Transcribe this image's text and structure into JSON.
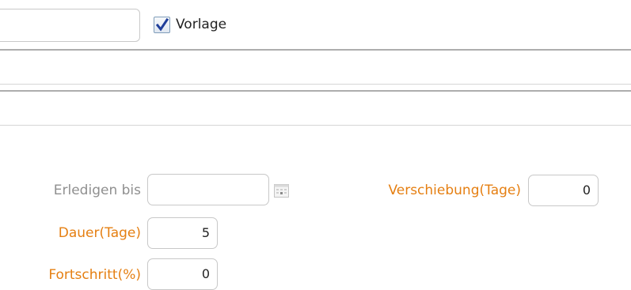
{
  "header": {
    "vorlage_label": "Vorlage",
    "vorlage_checked": true
  },
  "form": {
    "erledigen_bis": {
      "label": "Erledigen bis",
      "value": ""
    },
    "verschiebung": {
      "label": "Verschiebung(Tage)",
      "value": "0"
    },
    "dauer": {
      "label": "Dauer(Tage)",
      "value": "5"
    },
    "fortschritt": {
      "label": "Fortschritt(%)",
      "value": "0"
    }
  },
  "colors": {
    "required_label": "#e57f12",
    "optional_label": "#8f8f8f",
    "checkbox_tick": "#1f3e9a"
  },
  "icons": [
    "checkmark-icon",
    "calendar-icon"
  ]
}
